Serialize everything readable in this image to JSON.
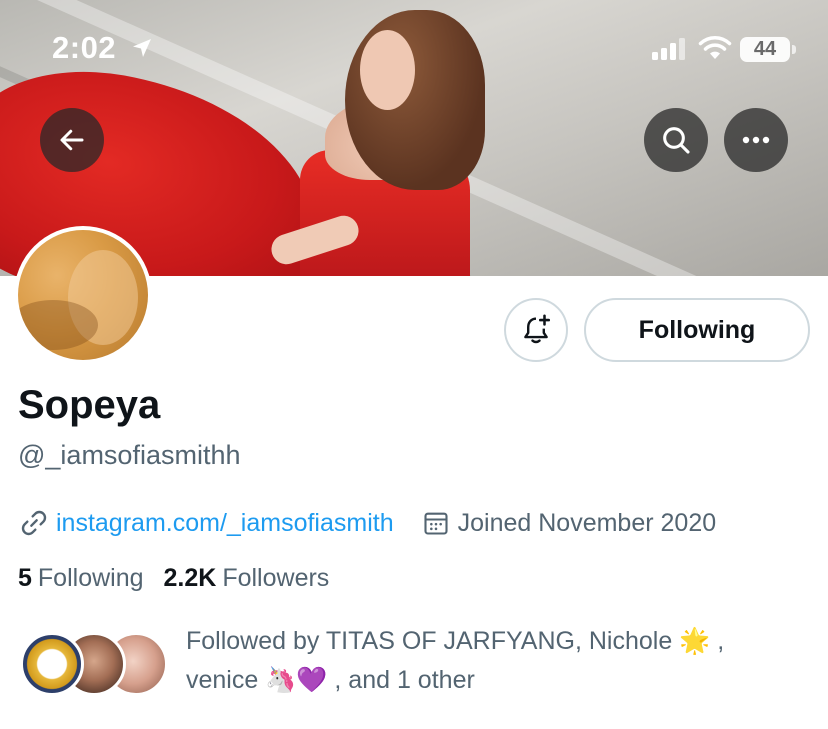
{
  "status_bar": {
    "time": "2:02",
    "battery": "44"
  },
  "header": {
    "back_icon": "arrow-left-icon",
    "search_icon": "search-icon",
    "more_icon": "more-horizontal-icon"
  },
  "profile": {
    "display_name": "Sopeya",
    "handle": "@_iamsofiasmithh",
    "website": "instagram.com/_iamsofiasmith",
    "joined": "Joined November 2020"
  },
  "actions": {
    "notify_icon": "bell-plus-icon",
    "following_label": "Following"
  },
  "stats": {
    "following_count": "5",
    "following_label": "Following",
    "followers_count": "2.2K",
    "followers_label": "Followers"
  },
  "followed_by": {
    "line1": "Followed by TITAS OF JARFYANG, Nichole 🌟 ,",
    "line2": "venice 🦄💜 , and 1 other"
  },
  "colors": {
    "link": "#1d9bf0",
    "secondary_text": "#536471",
    "primary_text": "#0f1419",
    "border": "#cfd9de"
  }
}
